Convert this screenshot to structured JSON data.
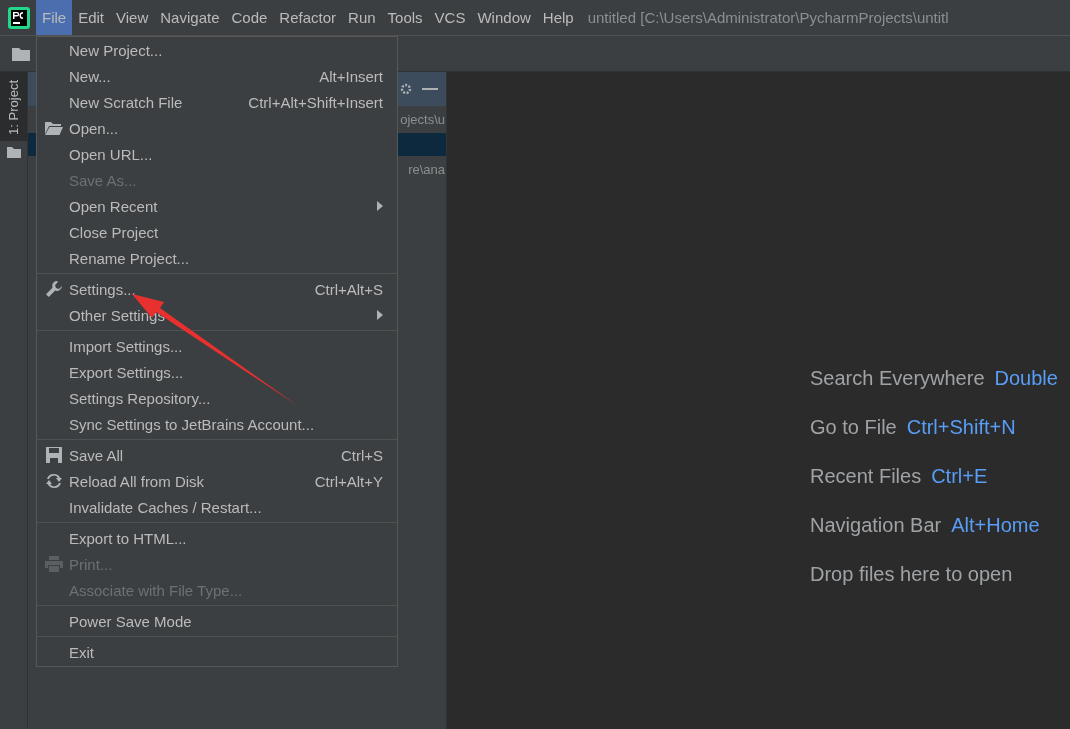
{
  "menu_bar": {
    "items": [
      {
        "label": "File",
        "selected": true
      },
      {
        "label": "Edit",
        "selected": false
      },
      {
        "label": "View",
        "selected": false
      },
      {
        "label": "Navigate",
        "selected": false
      },
      {
        "label": "Code",
        "selected": false
      },
      {
        "label": "Refactor",
        "selected": false
      },
      {
        "label": "Run",
        "selected": false
      },
      {
        "label": "Tools",
        "selected": false
      },
      {
        "label": "VCS",
        "selected": false
      },
      {
        "label": "Window",
        "selected": false
      },
      {
        "label": "Help",
        "selected": false
      }
    ],
    "title": "untitled [C:\\Users\\Administrator\\PycharmProjects\\untitl"
  },
  "tool_strip": {
    "tabs": [
      {
        "label": "1: Project",
        "selected": true
      }
    ]
  },
  "project_panel": {
    "rows": [
      {
        "text": "ojects\\u",
        "selected": false
      },
      {
        "selected": true
      },
      {
        "text": "re\\ana",
        "selected": false
      }
    ]
  },
  "file_menu": {
    "groups": [
      [
        {
          "label": "New Project..."
        },
        {
          "label": "New...",
          "shortcut": "Alt+Insert"
        },
        {
          "label": "New Scratch File",
          "shortcut": "Ctrl+Alt+Shift+Insert"
        },
        {
          "label": "Open...",
          "kind": "folder"
        },
        {
          "label": "Open URL..."
        },
        {
          "label": "Save As...",
          "disabled": true
        },
        {
          "label": "Open Recent",
          "submenu": true
        },
        {
          "label": "Close Project"
        },
        {
          "label": "Rename Project..."
        }
      ],
      [
        {
          "label": "Settings...",
          "kind": "wrench",
          "shortcut": "Ctrl+Alt+S"
        },
        {
          "label": "Other Settings",
          "submenu": true
        }
      ],
      [
        {
          "label": "Import Settings..."
        },
        {
          "label": "Export Settings..."
        },
        {
          "label": "Settings Repository..."
        },
        {
          "label": "Sync Settings to JetBrains Account..."
        }
      ],
      [
        {
          "label": "Save All",
          "kind": "save",
          "shortcut": "Ctrl+S"
        },
        {
          "label": "Reload All from Disk",
          "kind": "reload",
          "shortcut": "Ctrl+Alt+Y"
        },
        {
          "label": "Invalidate Caches / Restart..."
        }
      ],
      [
        {
          "label": "Export to HTML..."
        },
        {
          "label": "Print...",
          "kind": "print",
          "disabled": true
        },
        {
          "label": "Associate with File Type...",
          "disabled": true
        }
      ],
      [
        {
          "label": "Power Save Mode"
        }
      ],
      [
        {
          "label": "Exit"
        }
      ]
    ]
  },
  "welcome": [
    {
      "label": "Search Everywhere",
      "shortcut": "Double"
    },
    {
      "label": "Go to File",
      "shortcut": "Ctrl+Shift+N"
    },
    {
      "label": "Recent Files",
      "shortcut": "Ctrl+E"
    },
    {
      "label": "Navigation Bar",
      "shortcut": "Alt+Home"
    },
    {
      "label": "Drop files here to open"
    }
  ]
}
